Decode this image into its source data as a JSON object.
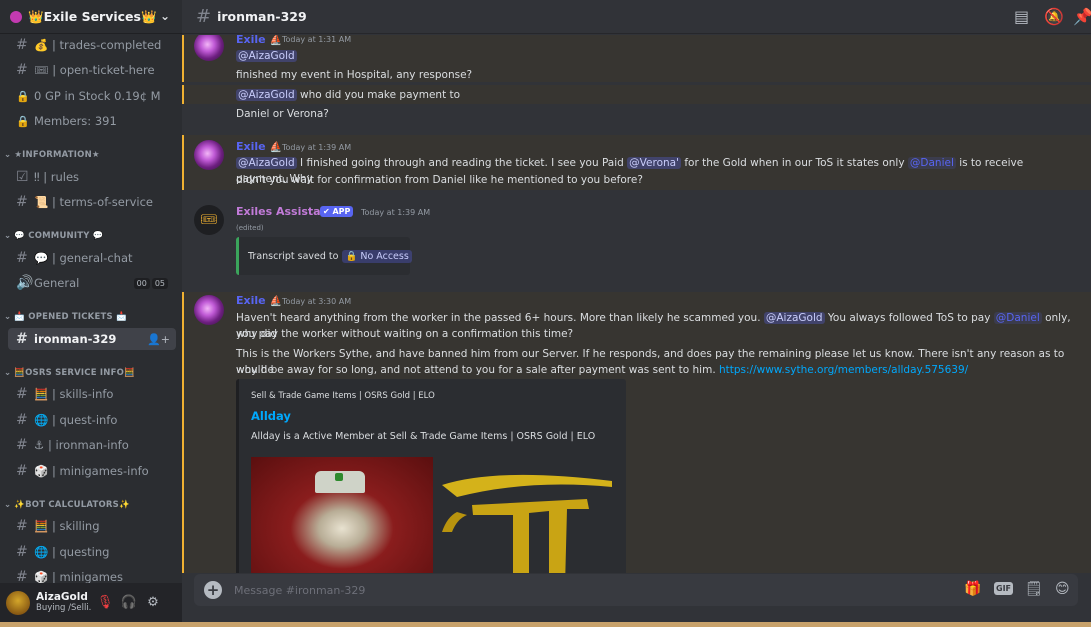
{
  "server": {
    "name": "👑Exile Services👑",
    "chevron_icon": "chevron-down-icon"
  },
  "sidebar": {
    "channels_top": [
      {
        "label": "💰 | trades-completed",
        "icon": "hash-icon"
      },
      {
        "label": "🎟 | open-ticket-here",
        "icon": "hash-icon"
      },
      {
        "label": "0 GP in Stock 0.19¢ M",
        "icon": "lock-icon"
      },
      {
        "label": "Members: 391",
        "icon": "lock-icon"
      }
    ],
    "cat_information": "★INFORMATION★",
    "information": [
      {
        "label": "‼ | rules"
      },
      {
        "label": "📜 | terms-of-service"
      }
    ],
    "cat_community": "💬 COMMUNITY 💬",
    "community": [
      {
        "label": "💬 | general-chat"
      },
      {
        "label": "General",
        "badge_a": "00",
        "badge_b": "05"
      }
    ],
    "cat_tickets": "📩 OPENED TICKETS 📩",
    "tickets": [
      {
        "label": "ironman-329"
      }
    ],
    "cat_osrs": "🧮OSRS SERVICE INFO🧮",
    "osrs": [
      {
        "label": "🧮 | skills-info"
      },
      {
        "label": "🌐 | quest-info"
      },
      {
        "label": "⚓ | ironman-info"
      },
      {
        "label": "🎲 | minigames-info"
      }
    ],
    "cat_bot": "✨BOT CALCULATORS✨",
    "bot": [
      {
        "label": "🧮 | skilling"
      },
      {
        "label": "🌐 | questing"
      },
      {
        "label": "🎲 | minigames"
      }
    ]
  },
  "user": {
    "name": "AizaGold",
    "status": "Buying /Selli..."
  },
  "topbar": {
    "channel": "ironman-329"
  },
  "messages": {
    "m1": {
      "author": "Exile",
      "time": "Today at 1:31 AM",
      "mention": "@AizaGold",
      "line2": "finished my event in Hospital, any response?",
      "line3_mention": "@AizaGold",
      "line3_text": " who did you make payment to",
      "line4": "Daniel or Verona?"
    },
    "m2": {
      "author": "Exile",
      "time": "Today at 1:39 AM",
      "mention1": "@AizaGold",
      "text1": " I finished going through and reading the ticket. I see you Paid ",
      "mention2": "@Verona'",
      "text2": " for the Gold when in our ToS it states only ",
      "mention3": "@Daniel",
      "text3": " is to receive payment. Why",
      "line2": "didn't you wait for confirmation from Daniel like he mentioned to you before?"
    },
    "m3": {
      "author": "Exiles Assistant",
      "app_tag": "✔ APP",
      "time": "Today at 1:39 AM",
      "edited": "(edited)",
      "transcript_text": "Transcript saved to",
      "transcript_badge": "🔒 No Access"
    },
    "m4": {
      "author": "Exile",
      "time": "Today at 3:30 AM",
      "text1": "Haven't heard anything from the worker in the passed 6+ hours. More than likely he scammed you. ",
      "mention1": "@AizaGold",
      "text2": " You always followed ToS to pay ",
      "mention2": "@Daniel",
      "text3": " only, why did",
      "line2": "you pay the worker without waiting on a confirmation this time?",
      "para1": "This is the Workers Sythe, and have banned him from our Server. If he responds, and does pay the remaining please let us know. There isn't any reason as to why he",
      "para2": "would be away for so long, and not attend to you for a sale after payment was sent to him. ",
      "link": "https://www.sythe.org/members/allday.575639/"
    },
    "embed": {
      "provider": "Sell & Trade Game Items | OSRS Gold | ELO",
      "title": "Allday",
      "description": "Allday is a Active Member at Sell & Trade Game Items | OSRS Gold | ELO"
    }
  },
  "composer": {
    "placeholder": "Message #ironman-329"
  }
}
